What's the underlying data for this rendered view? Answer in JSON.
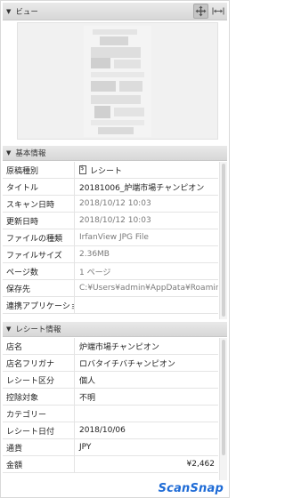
{
  "view": {
    "title": "ビュー",
    "tools": [
      {
        "icon": "move-icon"
      },
      {
        "icon": "fit-width-icon"
      }
    ]
  },
  "basic": {
    "title": "基本情報",
    "rows": [
      {
        "key": "原稿種別",
        "value": "レシート",
        "icon": "receipt-icon"
      },
      {
        "key": "タイトル",
        "value": "20181006_炉端市場チャンピオン"
      },
      {
        "key": "スキャン日時",
        "value": "2018/10/12 10:03",
        "gray": true
      },
      {
        "key": "更新日時",
        "value": "2018/10/12 10:03",
        "gray": true
      },
      {
        "key": "ファイルの種類",
        "value": "IrfanView JPG File",
        "gray": true
      },
      {
        "key": "ファイルサイズ",
        "value": "2.36MB",
        "gray": true
      },
      {
        "key": "ページ数",
        "value": "1 ページ",
        "gray": true
      },
      {
        "key": "保存先",
        "value": "C:¥Users¥admin¥AppData¥Roamin...",
        "gray": true
      },
      {
        "key": "連携アプリケーション",
        "value": ""
      }
    ]
  },
  "receipt": {
    "title": "レシート情報",
    "rows": [
      {
        "key": "店名",
        "value": "炉端市場チャンピオン"
      },
      {
        "key": "店名フリガナ",
        "value": "ロバタイチバチャンピオン"
      },
      {
        "key": "レシート区分",
        "value": "個人"
      },
      {
        "key": "控除対象",
        "value": "不明"
      },
      {
        "key": "カテゴリー",
        "value": ""
      },
      {
        "key": "レシート日付",
        "value": "2018/10/06"
      },
      {
        "key": "通貨",
        "value": "JPY"
      },
      {
        "key": "金額",
        "value": "¥2,462",
        "right": true
      }
    ]
  },
  "footer": {
    "logo": "ScanSnap"
  },
  "colors": {
    "accent": "#1e6bd6"
  }
}
